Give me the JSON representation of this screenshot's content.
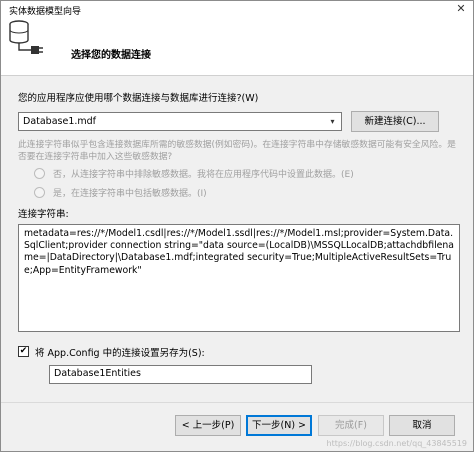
{
  "window": {
    "title": "实体数据模型向导",
    "close_glyph": "✕"
  },
  "header": {
    "title": "选择您的数据连接",
    "icon": "database-connection-icon"
  },
  "question": "您的应用程序应使用哪个数据连接与数据库进行连接?(W)",
  "connection_combo": {
    "value": "Database1.mdf",
    "arrow_glyph": "▾"
  },
  "buttons": {
    "new_connection": "新建连接(C)...",
    "prev": "< 上一步(P)",
    "next": "下一步(N) >",
    "finish": "完成(F)",
    "cancel": "取消"
  },
  "sensitive_warning": "此连接字符串似乎包含连接数据库所需的敏感数据(例如密码)。在连接字符串中存储敏感数据可能有安全风险。是否要在连接字符串中加入这些敏感数据?",
  "radio_options": [
    {
      "label": "否，从连接字符串中排除敏感数据。我将在应用程序代码中设置此数据。(E)",
      "selected": false
    },
    {
      "label": "是，在连接字符串中包括敏感数据。(I)",
      "selected": false
    }
  ],
  "connection_string": {
    "label": "连接字符串:",
    "value": "metadata=res://*/Model1.csdl|res://*/Model1.ssdl|res://*/Model1.msl;provider=System.Data.SqlClient;provider connection string=\"data source=(LocalDB)\\MSSQLLocalDB;attachdbfilename=|DataDirectory|\\Database1.mdf;integrated security=True;MultipleActiveResultSets=True;App=EntityFramework\""
  },
  "save_settings": {
    "checked": true,
    "check_glyph": "✔",
    "label": "将 App.Config 中的连接设置另存为(S):",
    "entity_name": "Database1Entities"
  },
  "watermark": "https://blog.csdn.net/qq_43845519"
}
